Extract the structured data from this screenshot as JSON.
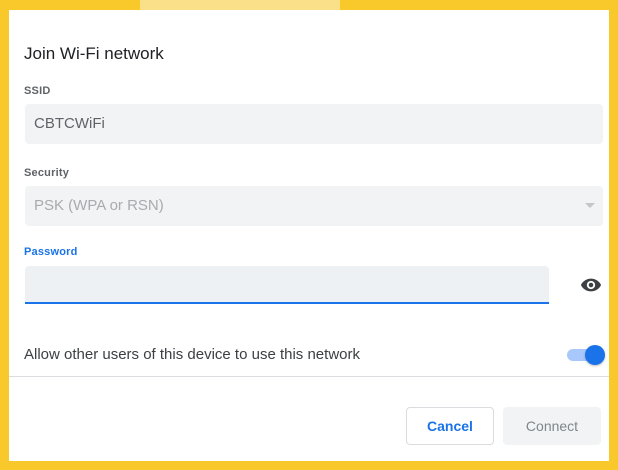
{
  "dialog": {
    "title": "Join Wi-Fi network",
    "ssid": {
      "label": "SSID",
      "value": "CBTCWiFi"
    },
    "security": {
      "label": "Security",
      "value": "PSK (WPA or RSN)"
    },
    "password": {
      "label": "Password",
      "value": "",
      "visibility_icon": "eye-icon"
    },
    "share": {
      "label": "Allow other users of this device to use this network",
      "enabled": true
    },
    "buttons": {
      "cancel": "Cancel",
      "connect": "Connect"
    }
  },
  "colors": {
    "frame": "#f9c92b",
    "accent": "#1a73e8",
    "field_bg": "#f1f3f4"
  }
}
